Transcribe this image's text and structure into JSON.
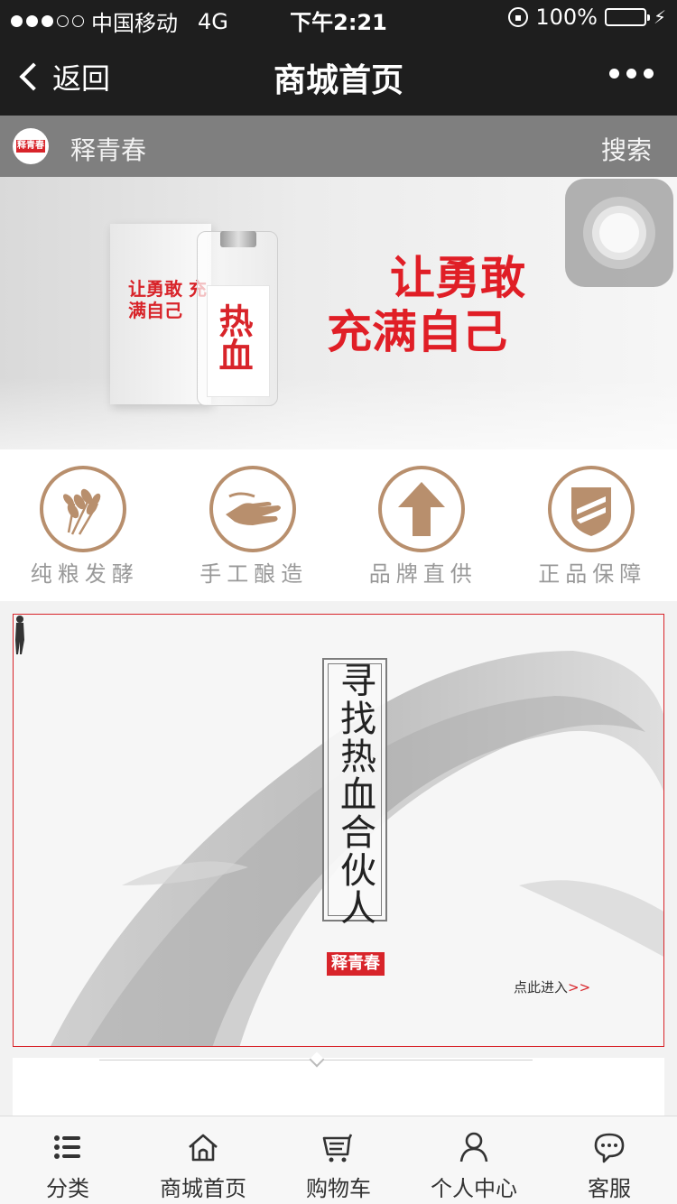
{
  "status_bar": {
    "carrier": "中国移动",
    "network": "4G",
    "time": "下午2:21",
    "battery": "100%",
    "battery_level": 1.0,
    "signal_bars_filled": 3,
    "signal_bars_total": 5
  },
  "nav": {
    "back_label": "返回",
    "title": "商城首页"
  },
  "shop": {
    "logo_text": "释青春",
    "name": "释青春",
    "search_label": "搜索"
  },
  "banner": {
    "slogan_line1": "让勇敢",
    "slogan_line2": "充满自己",
    "box_text": "让勇敢 充满自己",
    "bottle_text": "热血",
    "page_count": 2,
    "active_page": 1,
    "colors": {
      "slogan": "#e01e26",
      "pager_active": "#ef5b8a"
    }
  },
  "features": [
    {
      "label": "纯粮发酵",
      "icon": "wheat-icon"
    },
    {
      "label": "手工酿造",
      "icon": "hand-icon"
    },
    {
      "label": "品牌直供",
      "icon": "up-arrow-icon"
    },
    {
      "label": "正品保障",
      "icon": "shield-icon"
    }
  ],
  "feature_color": "#b88f6d",
  "promo": {
    "title": "寻找热血合伙人",
    "brand": "释青春",
    "enter_label": "点此进入",
    "enter_arrows": ">>"
  },
  "tabbar": [
    {
      "label": "分类",
      "icon": "list-icon"
    },
    {
      "label": "商城首页",
      "icon": "home-icon"
    },
    {
      "label": "购物车",
      "icon": "cart-icon"
    },
    {
      "label": "个人中心",
      "icon": "person-icon"
    },
    {
      "label": "客服",
      "icon": "chat-icon"
    }
  ]
}
